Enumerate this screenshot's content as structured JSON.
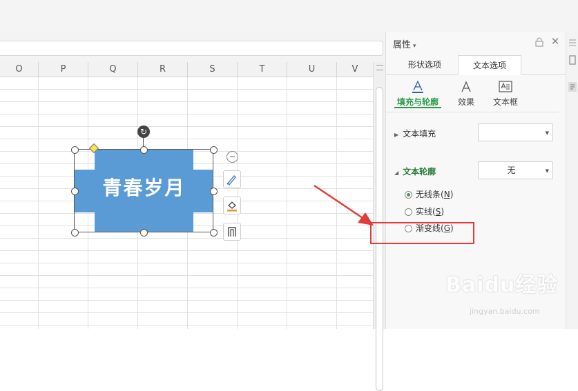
{
  "columns": [
    "O",
    "P",
    "Q",
    "R",
    "S",
    "T",
    "U",
    "V"
  ],
  "shape": {
    "text": "青春岁月",
    "fill_color": "#5b9bd5"
  },
  "panel": {
    "title": "属性",
    "tabs": [
      {
        "label": "形状选项",
        "active": false
      },
      {
        "label": "文本选项",
        "active": true
      }
    ],
    "subtabs": [
      {
        "label": "填充与轮廓",
        "active": true
      },
      {
        "label": "效果",
        "active": false
      },
      {
        "label": "文本框",
        "active": false
      }
    ],
    "text_fill": {
      "label": "文本填充",
      "value": ""
    },
    "text_outline": {
      "label": "文本轮廓",
      "value": "无"
    },
    "options": [
      {
        "label": "无线条",
        "key": "N",
        "selected": true
      },
      {
        "label": "实线",
        "key": "S",
        "selected": false
      },
      {
        "label": "渐变线",
        "key": "G",
        "selected": false
      }
    ]
  },
  "watermark": {
    "brand": "Baidu经验",
    "url": "jingyan.baidu.com"
  },
  "colors": {
    "accent_green": "#2b9b4a",
    "annotation_red": "#e33b3b"
  }
}
